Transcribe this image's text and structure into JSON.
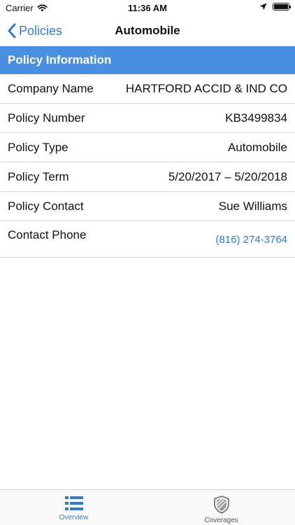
{
  "status_bar": {
    "carrier": "Carrier",
    "time": "11:36 AM"
  },
  "nav": {
    "back_label": "Policies",
    "title": "Automobile"
  },
  "section": {
    "title": "Policy Information"
  },
  "rows": [
    {
      "label": "Company Name",
      "value": "HARTFORD ACCID & IND CO"
    },
    {
      "label": "Policy Number",
      "value": "KB3499834"
    },
    {
      "label": "Policy Type",
      "value": "Automobile"
    },
    {
      "label": "Policy Term",
      "value": "5/20/2017 – 5/20/2018"
    },
    {
      "label": "Policy Contact",
      "value": "Sue Williams"
    },
    {
      "label": "Contact Phone",
      "value": "(816) 274-3764"
    }
  ],
  "tabs": [
    {
      "label": "Overview",
      "icon": "list-icon",
      "active": true
    },
    {
      "label": "Coverages",
      "icon": "shield-icon",
      "active": false
    }
  ],
  "colors": {
    "accent": "#3478d4",
    "header_bg": "#4a90e2"
  }
}
